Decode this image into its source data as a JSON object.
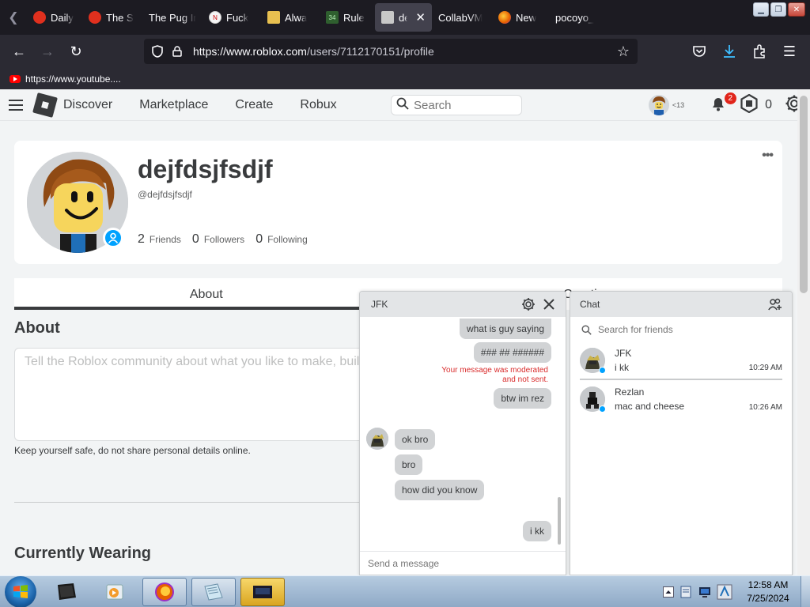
{
  "browser": {
    "tabs": [
      {
        "label": "Daily",
        "icon": "tomato-icon",
        "color": "#e0301e"
      },
      {
        "label": "The S",
        "icon": "tomato-icon",
        "color": "#e0301e"
      },
      {
        "label": "The Pug Ir",
        "icon": "",
        "color": ""
      },
      {
        "label": "Fuck",
        "icon": "new-badge-icon",
        "color": "#f5f5f5"
      },
      {
        "label": "Alwa",
        "icon": "image-icon",
        "color": "#e8c050"
      },
      {
        "label": "Rule",
        "icon": "rule34-icon",
        "color": "#2f5f2f"
      },
      {
        "label": "dej",
        "icon": "roblox-icon",
        "color": "#c8c8c8"
      },
      {
        "label": "CollabVM",
        "icon": "",
        "color": ""
      },
      {
        "label": "New",
        "icon": "firefox-icon",
        "color": "#e66000"
      },
      {
        "label": "pocoyo_",
        "icon": "",
        "color": ""
      }
    ],
    "active_tab_index": 6,
    "url_domain": "https://www.roblox.com",
    "url_path": "/users/7112170151/profile",
    "bookmark": "https://www.youtube...."
  },
  "roblox_header": {
    "nav": [
      "Discover",
      "Marketplace",
      "Create",
      "Robux"
    ],
    "search_placeholder": "Search",
    "age_label": "<13",
    "notifications": "2",
    "robux": "0"
  },
  "profile": {
    "display_name": "dejfdsjfsdjf",
    "username": "@dejfdsjfsdjf",
    "friends_count": "2",
    "friends_label": "Friends",
    "followers_count": "0",
    "followers_label": "Followers",
    "following_count": "0",
    "following_label": "Following",
    "more": "•••"
  },
  "tabs": {
    "about": "About",
    "creations": "Creations"
  },
  "about": {
    "title": "About",
    "placeholder": "Tell the Roblox community about what you like to make, build",
    "safety": "Keep yourself safe, do not share personal details online.",
    "wearing_title": "Currently Wearing"
  },
  "conversation": {
    "title": "JFK",
    "messages": [
      {
        "from": "me",
        "text": "what is guy saying"
      },
      {
        "from": "me",
        "text": "### ## ######"
      },
      {
        "from": "system",
        "text": "Your message was moderated and not sent."
      },
      {
        "from": "me",
        "text": "btw im rez"
      },
      {
        "from": "them",
        "text": "ok bro"
      },
      {
        "from": "them",
        "text": "bro"
      },
      {
        "from": "them",
        "text": "how did you know"
      },
      {
        "from": "me",
        "text": "i kk"
      }
    ],
    "moderation_line1": "Your message was moderated",
    "moderation_line2": "and not sent.",
    "input_placeholder": "Send a message"
  },
  "chat_list": {
    "title": "Chat",
    "search_placeholder": "Search for friends",
    "conversations": [
      {
        "name": "JFK",
        "preview": "i kk",
        "time": "10:29 AM"
      },
      {
        "name": "Rezlan",
        "preview": "mac and cheese",
        "time": "10:26 AM"
      }
    ]
  },
  "taskbar": {
    "time": "12:58 AM",
    "date": "7/25/2024"
  },
  "colors": {
    "accent": "#00a2ff",
    "notification": "#e1251b",
    "moderated": "#d92b2b"
  }
}
